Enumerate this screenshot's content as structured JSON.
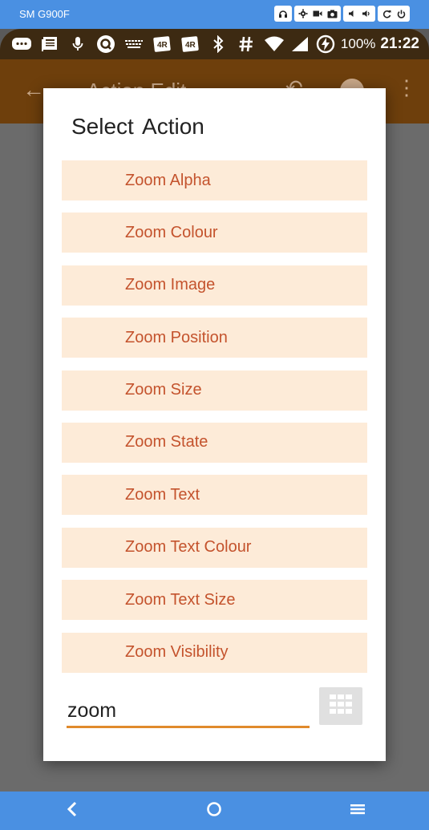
{
  "device": {
    "name": "SM G900F",
    "controls": [
      "headset-icon",
      "settings-icon",
      "video-icon",
      "camera-icon",
      "volume-down-icon",
      "volume-up-icon",
      "rotate-icon",
      "power-icon"
    ]
  },
  "status_bar": {
    "battery": "100%",
    "time": "21:22",
    "icons": [
      "chat-icon",
      "news-icon",
      "mic-icon",
      "q-icon",
      "keyboard-icon",
      "notes-icon",
      "notes-alt-icon",
      "bluetooth-icon",
      "hash-icon",
      "wifi-icon",
      "signal-icon",
      "battery-charging-icon"
    ]
  },
  "app_bar": {
    "title": "Action Edit"
  },
  "dialog": {
    "title": "Select  Action",
    "actions": [
      "Zoom Alpha",
      "Zoom Colour",
      "Zoom Image",
      "Zoom Position",
      "Zoom Size",
      "Zoom State",
      "Zoom Text",
      "Zoom Text Colour",
      "Zoom Text Size",
      "Zoom Visibility"
    ],
    "search_value": "zoom"
  },
  "colors": {
    "device_bar": "#4a90e2",
    "action_bg": "#fdebd8",
    "action_text": "#c4532d",
    "input_underline": "#e08a2c"
  }
}
